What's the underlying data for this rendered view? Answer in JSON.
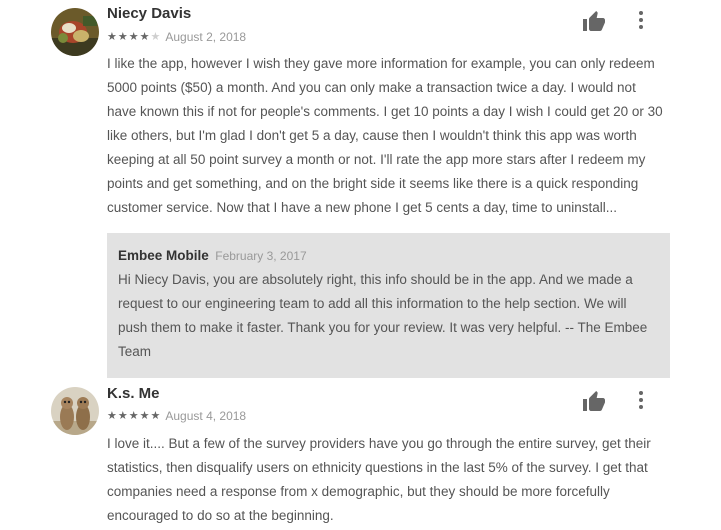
{
  "reviews": [
    {
      "author": "Niecy Davis",
      "rating": 4,
      "date": "August 2, 2018",
      "text": "I like the app, however I wish they gave more information for example, you can only redeem 5000 points ($50) a month. And you can only make a transaction twice a day. I would not have known this if not for people's comments. I get 10 points a day I wish I could get 20 or 30 like others, but I'm glad I don't get 5 a day, cause then I wouldn't think this app was worth keeping at all 50 point survey a month or not. I'll rate the app more stars after I redeem my points and get something, and on the bright side it seems like there is a quick responding customer service. Now that I have a new phone I get 5 cents a day, time to uninstall...",
      "reply": {
        "author": "Embee Mobile",
        "date": "February 3, 2017",
        "text": "Hi Niecy Davis, you are absolutely right, this info should be in the app. And we made a request to our engineering team to add all this information to the help section. We will push them to make it faster. Thank you for your review. It was very helpful. -- The Embee Team"
      }
    },
    {
      "author": "K.s. Me",
      "rating": 5,
      "date": "August 4, 2018",
      "text": "I love it.... But a few of the survey providers have you go through the entire survey, get their statistics, then disqualify users on ethnicity questions in the last 5% of the survey. I get that companies need a response from x demographic, but they should be more forcefully encouraged to do so at the beginning."
    }
  ],
  "icons": {
    "helpful": "thumbs-up-icon",
    "more": "more-vertical-icon",
    "star": "star-icon"
  },
  "colors": {
    "star_filled": "#666666",
    "star_empty": "#cfcfcf",
    "reply_background": "#e2e2e2"
  }
}
